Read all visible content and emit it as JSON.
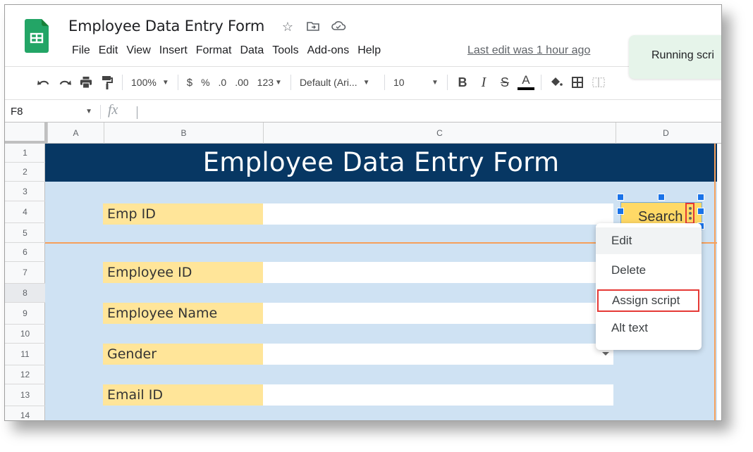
{
  "app": {
    "doc_title": "Employee Data Entry Form",
    "logo_icon": "google-sheets-logo",
    "title_icons": [
      "star-icon",
      "move-to-folder-icon",
      "cloud-saved-icon"
    ]
  },
  "menubar": {
    "items": [
      "File",
      "Edit",
      "View",
      "Insert",
      "Format",
      "Data",
      "Tools",
      "Add-ons",
      "Help"
    ],
    "last_edit": "Last edit was 1 hour ago"
  },
  "toast": {
    "text": "Running scri"
  },
  "toolbar": {
    "zoom": "100%",
    "currency": "$",
    "percent": "%",
    "decrease_decimal": ".0",
    "increase_decimal": ".00",
    "more_formats": "123",
    "font": "Default (Ari...",
    "font_size": "10",
    "bold": "B",
    "italic": "I",
    "strikethrough": "S",
    "text_color": "A"
  },
  "formula_bar": {
    "name_box": "F8",
    "fx": "fx",
    "value": ""
  },
  "grid": {
    "columns": [
      "A",
      "B",
      "C",
      "D"
    ],
    "rows": [
      "1",
      "2",
      "3",
      "4",
      "5",
      "6",
      "7",
      "8",
      "9",
      "10",
      "11",
      "12",
      "13",
      "14"
    ],
    "selected_row": "8"
  },
  "form": {
    "banner_title": "Employee Data Entry Form",
    "search_label": "Emp ID",
    "search_value": "",
    "fields": [
      {
        "label": "Employee ID",
        "value": ""
      },
      {
        "label": "Employee Name",
        "value": ""
      },
      {
        "label": "Gender",
        "value": "",
        "type": "dropdown"
      },
      {
        "label": "Email ID",
        "value": ""
      }
    ],
    "search_button": "Search"
  },
  "context_menu": {
    "items": [
      "Edit",
      "Delete",
      "Assign script",
      "Alt text"
    ],
    "highlighted": "Assign script"
  },
  "colors": {
    "banner": "#073763",
    "form_bg": "#cfe2f3",
    "label_bg": "#ffe599",
    "button_bg": "#ffd966",
    "accent_orange": "#f6a05a",
    "highlight_red": "#e53935",
    "selection_blue": "#1a73e8"
  }
}
